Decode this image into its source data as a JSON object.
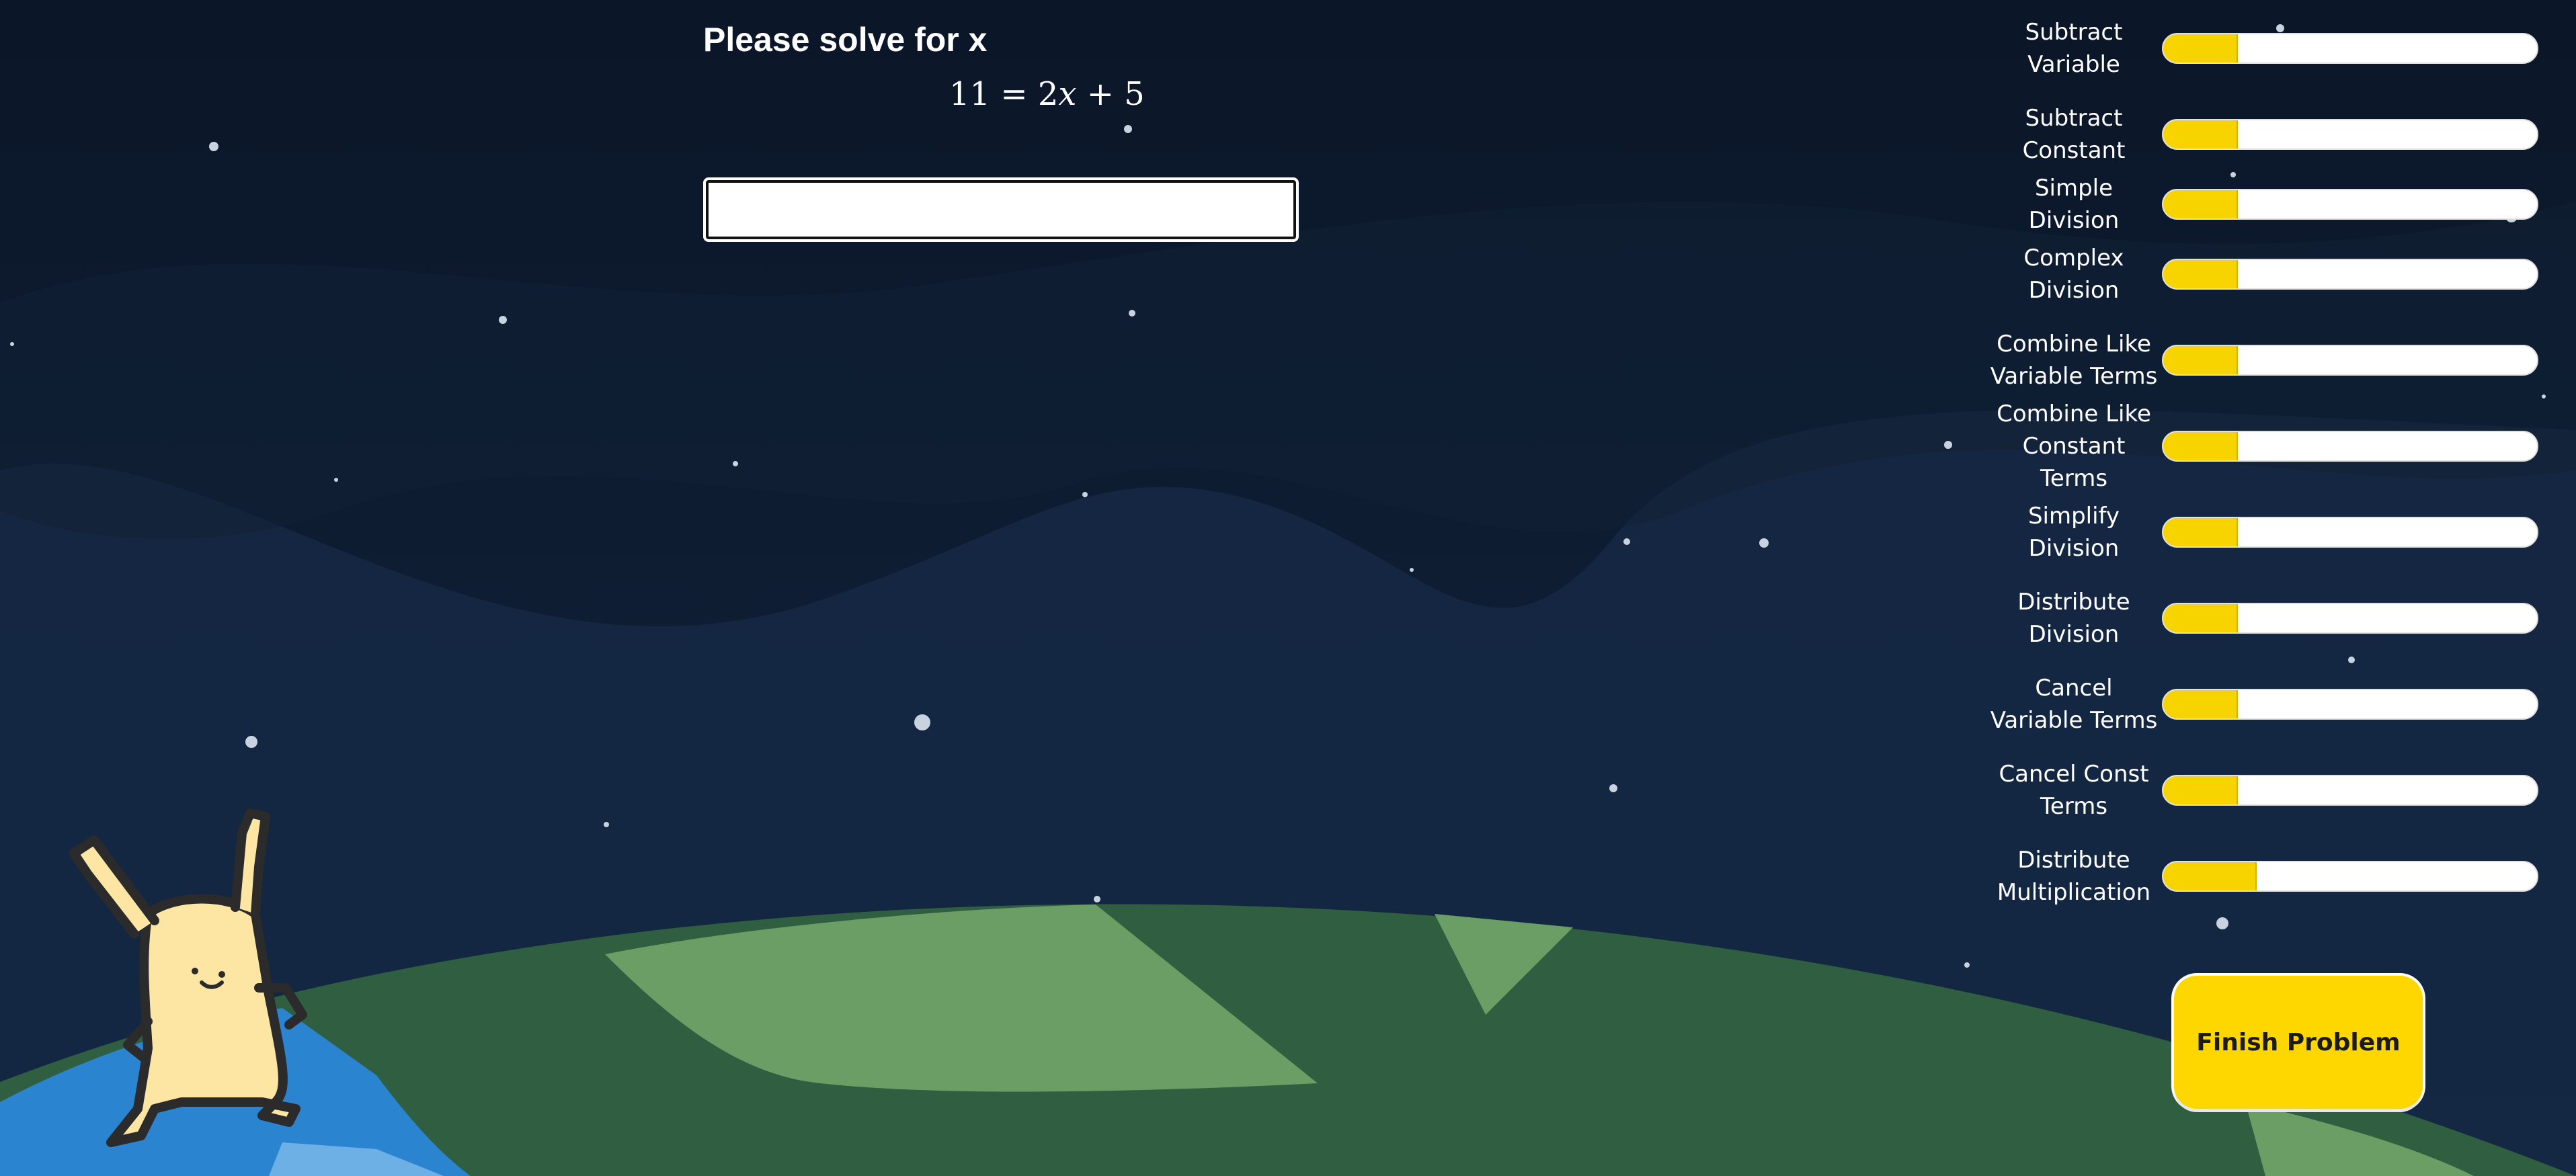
{
  "problem": {
    "prompt": "Please solve for x",
    "equation": {
      "left": "11",
      "eq": "=",
      "coef": "2",
      "var": "x",
      "op": "+",
      "const": "5"
    },
    "answer_value": "",
    "answer_placeholder": ""
  },
  "skills": [
    {
      "label": "Subtract Variable",
      "progress": 0.2
    },
    {
      "label": "Subtract Constant",
      "progress": 0.2
    },
    {
      "label": "Simple Division",
      "progress": 0.2
    },
    {
      "label": "Complex Division",
      "progress": 0.2
    },
    {
      "label": "Combine Like Variable Terms",
      "progress": 0.2
    },
    {
      "label": "Combine Like Constant Terms",
      "progress": 0.2
    },
    {
      "label": "Simplify Division",
      "progress": 0.2
    },
    {
      "label": "Distribute Division",
      "progress": 0.2
    },
    {
      "label": "Cancel Variable Terms",
      "progress": 0.2
    },
    {
      "label": "Cancel Const Terms",
      "progress": 0.2
    },
    {
      "label": "Distribute Multiplication",
      "progress": 0.25
    }
  ],
  "finish_button": {
    "label": "Finish Problem"
  },
  "colors": {
    "sky": "#0c1a2e",
    "hills": "#16283f",
    "planet_dark": "#2f5e40",
    "planet_light": "#6a9e65",
    "water": "#2b84d0",
    "creature": "#fde5a4",
    "progress_fill": "#f7d300",
    "button": "#fed700"
  }
}
